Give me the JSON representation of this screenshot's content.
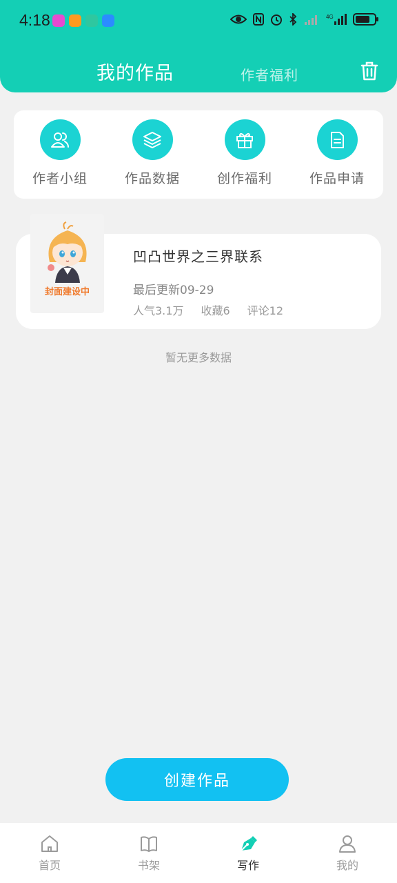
{
  "status_bar": {
    "time": "4:18",
    "app_icon_colors": [
      "#e64bd0",
      "#ff9a1f",
      "#2ec7a0",
      "#2b8cff"
    ]
  },
  "header": {
    "title": "我的作品",
    "welfare_tab": "作者福利",
    "trash_icon": "trash-icon",
    "background": "#14cfb5"
  },
  "quick_actions": [
    {
      "label": "作者小组",
      "icon": "users-icon"
    },
    {
      "label": "作品数据",
      "icon": "layers-icon"
    },
    {
      "label": "创作福利",
      "icon": "gift-icon"
    },
    {
      "label": "作品申请",
      "icon": "document-icon"
    }
  ],
  "work": {
    "cover_text": "封面建设中",
    "title": "凹凸世界之三界联系",
    "updated": "最后更新09-29",
    "popularity": "人气3.1万",
    "favorites": "收藏6",
    "comments": "评论12"
  },
  "no_more": "暂无更多数据",
  "create_button": "创建作品",
  "bottom_nav": [
    {
      "label": "首页",
      "icon": "home-icon",
      "active": false
    },
    {
      "label": "书架",
      "icon": "book-icon",
      "active": false
    },
    {
      "label": "写作",
      "icon": "pen-icon",
      "active": true
    },
    {
      "label": "我的",
      "icon": "user-icon",
      "active": false
    }
  ],
  "colors": {
    "accent": "#14cfb5",
    "icon_circle": "#1bd3d3",
    "button": "#12c1f2",
    "cover_text": "#f07a2c"
  }
}
